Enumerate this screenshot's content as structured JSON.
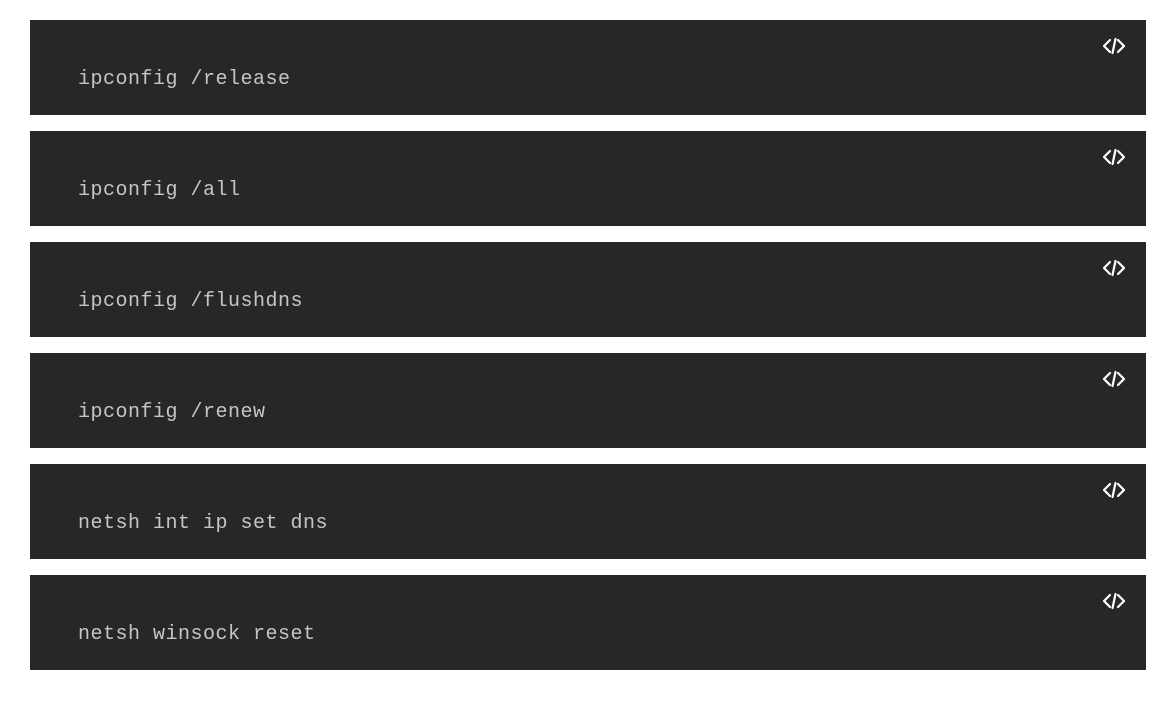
{
  "blocks": [
    {
      "command": "ipconfig /release"
    },
    {
      "command": "ipconfig /all"
    },
    {
      "command": "ipconfig /flushdns"
    },
    {
      "command": "ipconfig /renew"
    },
    {
      "command": "netsh int ip set dns"
    },
    {
      "command": "netsh winsock reset"
    }
  ]
}
